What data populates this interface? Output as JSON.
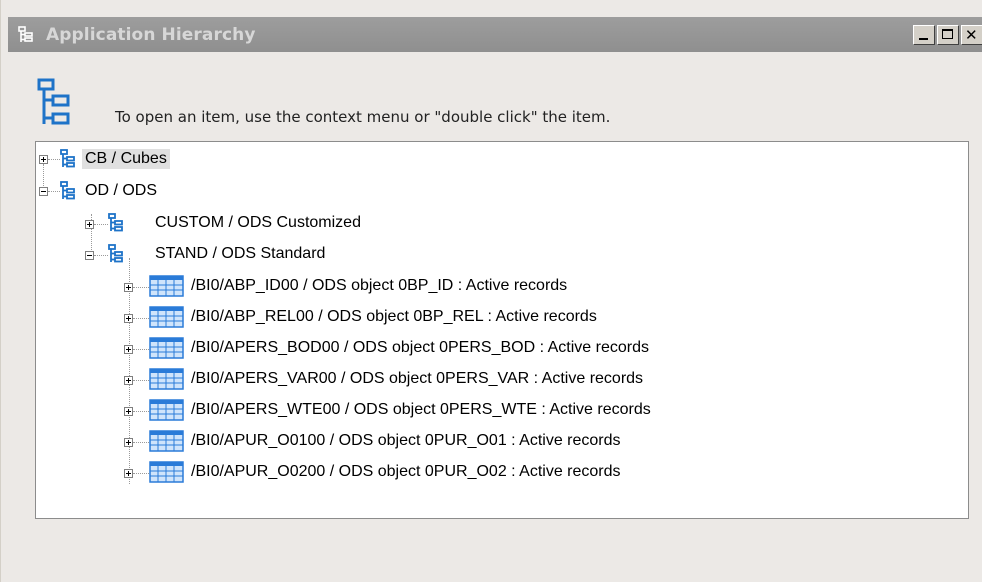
{
  "window": {
    "title": "Application Hierarchy",
    "buttons": {
      "minimize": "minimize",
      "maximize": "maximize",
      "close": "close"
    }
  },
  "hint_text": "To open an item, use the context menu or \"double click\" the item.",
  "tree": {
    "nodes": [
      {
        "label": "CB / Cubes",
        "icon": "hierarchy-icon",
        "expanded": false,
        "selected": true
      },
      {
        "label": "OD / ODS",
        "icon": "hierarchy-icon",
        "expanded": true
      },
      {
        "label": "CUSTOM / ODS Customized",
        "icon": "hierarchy-icon",
        "expanded": false
      },
      {
        "label": "STAND / ODS Standard",
        "icon": "hierarchy-icon",
        "expanded": true
      },
      {
        "label": "/BI0/ABP_ID00 / ODS object 0BP_ID : Active records",
        "icon": "table-icon",
        "expanded": false
      },
      {
        "label": "/BI0/ABP_REL00 / ODS object 0BP_REL : Active records",
        "icon": "table-icon",
        "expanded": false
      },
      {
        "label": "/BI0/APERS_BOD00 / ODS object 0PERS_BOD : Active records",
        "icon": "table-icon",
        "expanded": false
      },
      {
        "label": "/BI0/APERS_VAR00 / ODS object 0PERS_VAR : Active records",
        "icon": "table-icon",
        "expanded": false
      },
      {
        "label": "/BI0/APERS_WTE00 / ODS object 0PERS_WTE : Active records",
        "icon": "table-icon",
        "expanded": false
      },
      {
        "label": "/BI0/APUR_O0100 / ODS object 0PUR_O01 : Active records",
        "icon": "table-icon",
        "expanded": false
      },
      {
        "label": "/BI0/APUR_O0200 / ODS object 0PUR_O02 : Active records",
        "icon": "table-icon",
        "expanded": false
      }
    ]
  },
  "colors": {
    "icon_blue": "#1e73c8",
    "table_blue": "#3a8ee6",
    "titlebar": "#949494"
  }
}
